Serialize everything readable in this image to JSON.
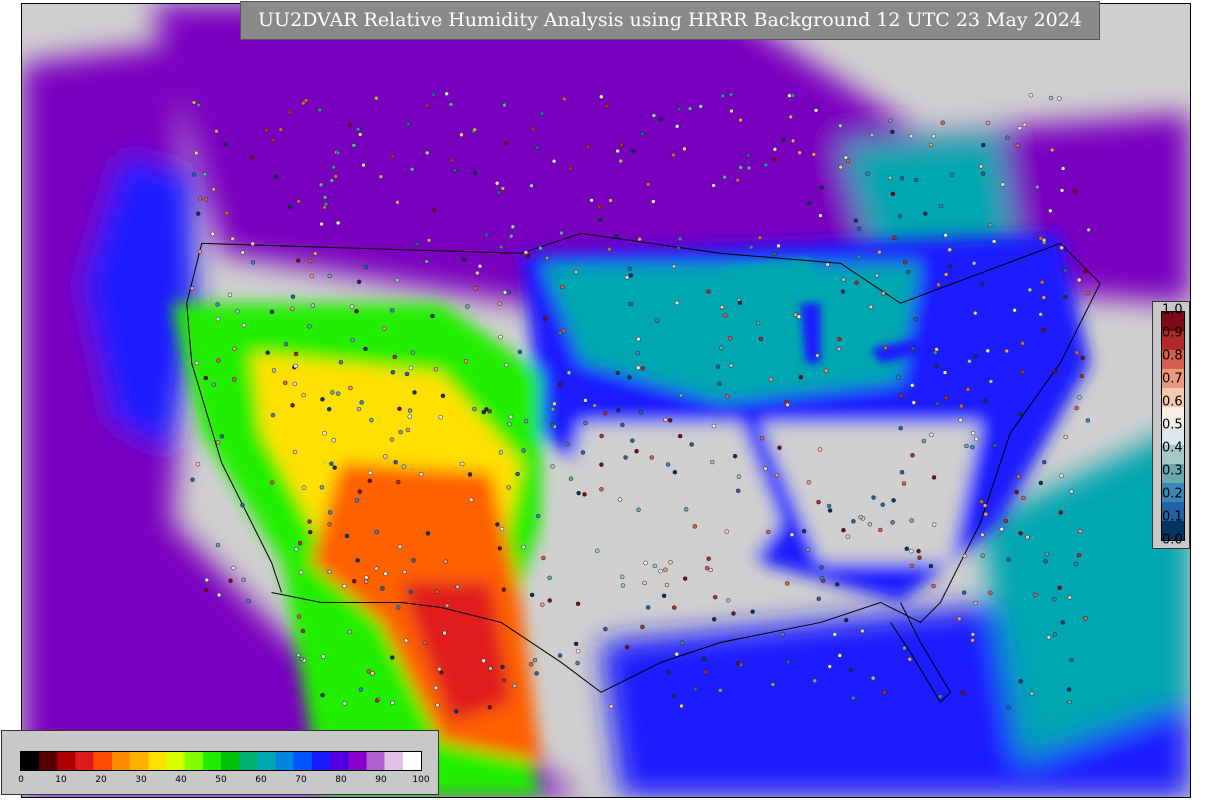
{
  "title": "UU2DVAR Relative Humidity Analysis using HRRR Background 12 UTC 23 May 2024",
  "rh_colorbar": {
    "ticks": [
      "0",
      "10",
      "20",
      "30",
      "40",
      "50",
      "60",
      "70",
      "80",
      "90",
      "100"
    ],
    "colors": [
      "#000000",
      "#5a0000",
      "#b00000",
      "#e01a1a",
      "#ff4b00",
      "#ff8c00",
      "#ffb000",
      "#ffe000",
      "#d8ff00",
      "#80ff00",
      "#20ee00",
      "#00c000",
      "#00b070",
      "#00a6b0",
      "#0086e0",
      "#0055ff",
      "#1a1aff",
      "#5000e0",
      "#8a00c8",
      "#b060d0",
      "#e0c0e8",
      "#ffffff"
    ]
  },
  "obs_colorbar": {
    "ticks": [
      "0.0",
      "0.1",
      "0.2",
      "0.3",
      "0.4",
      "0.5",
      "0.6",
      "0.7",
      "0.8",
      "0.9",
      "1.0"
    ],
    "colors": [
      "#06335f",
      "#1f64a8",
      "#3a86b8",
      "#6aa8b0",
      "#a4c8c8",
      "#dde6ea",
      "#f6eee6",
      "#f5c8b0",
      "#e89a80",
      "#d66050",
      "#b02a2a",
      "#7a0a14"
    ]
  },
  "map_colors": {
    "land_dry": "#cfcfcf",
    "humid": "#7a00c0",
    "very_humid": "#1a1aff",
    "moist": "#00a6b0",
    "semi_arid": "#20ee00",
    "arid": "#ffe000",
    "very_arid": "#ff6000",
    "extreme_arid": "#e01a1a"
  }
}
